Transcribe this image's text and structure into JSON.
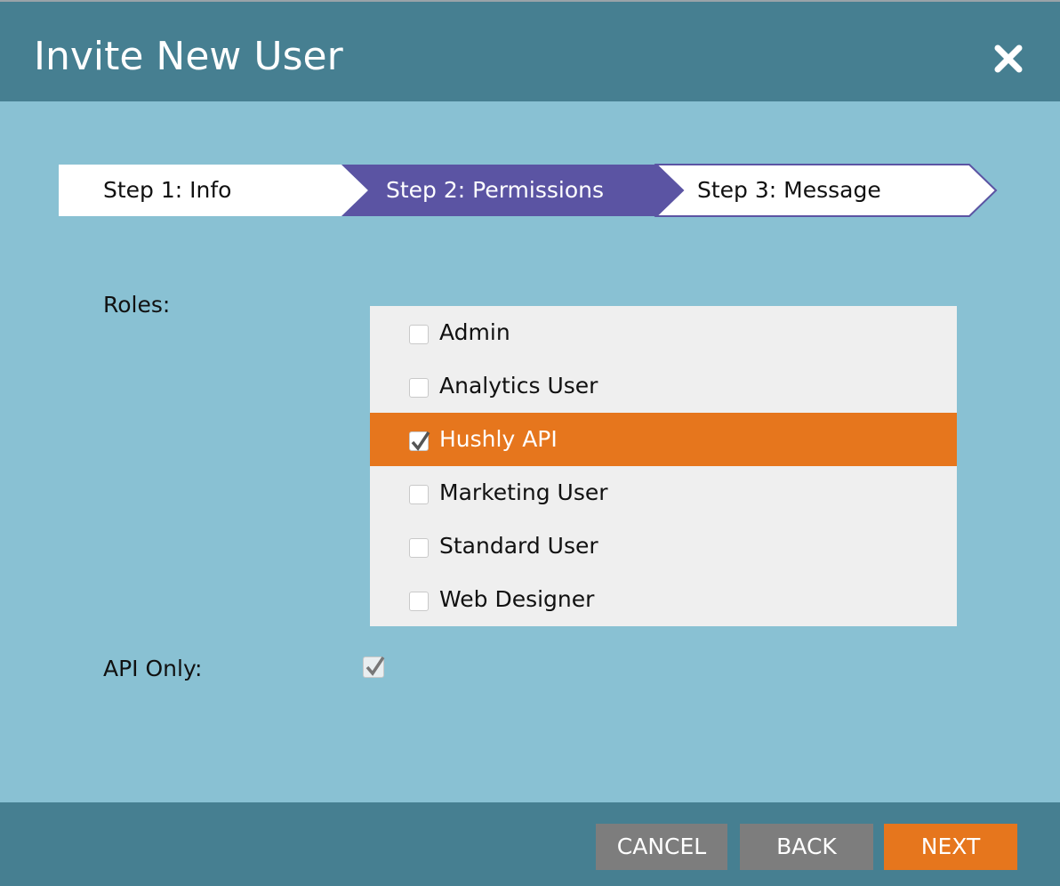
{
  "dialog": {
    "title": "Invite New User",
    "close_icon": "close-icon"
  },
  "steps": [
    {
      "label": "Step 1: Info",
      "active": false
    },
    {
      "label": "Step 2: Permissions",
      "active": true
    },
    {
      "label": "Step 3: Message",
      "active": false
    }
  ],
  "roles": {
    "label": "Roles:",
    "items": [
      {
        "label": "Admin",
        "checked": false
      },
      {
        "label": "Analytics User",
        "checked": false
      },
      {
        "label": "Hushly API",
        "checked": true
      },
      {
        "label": "Marketing User",
        "checked": false
      },
      {
        "label": "Standard User",
        "checked": false
      },
      {
        "label": "Web Designer",
        "checked": false
      }
    ]
  },
  "api_only": {
    "label": "API Only:",
    "checked": true
  },
  "footer": {
    "cancel_label": "CANCEL",
    "back_label": "BACK",
    "next_label": "NEXT"
  },
  "colors": {
    "header_bg": "#467f91",
    "body_bg": "#89c1d3",
    "active_step": "#5b54a3",
    "selected_row": "#e6761d",
    "next_button": "#e6761d",
    "gray_button": "#7d7d7d"
  }
}
